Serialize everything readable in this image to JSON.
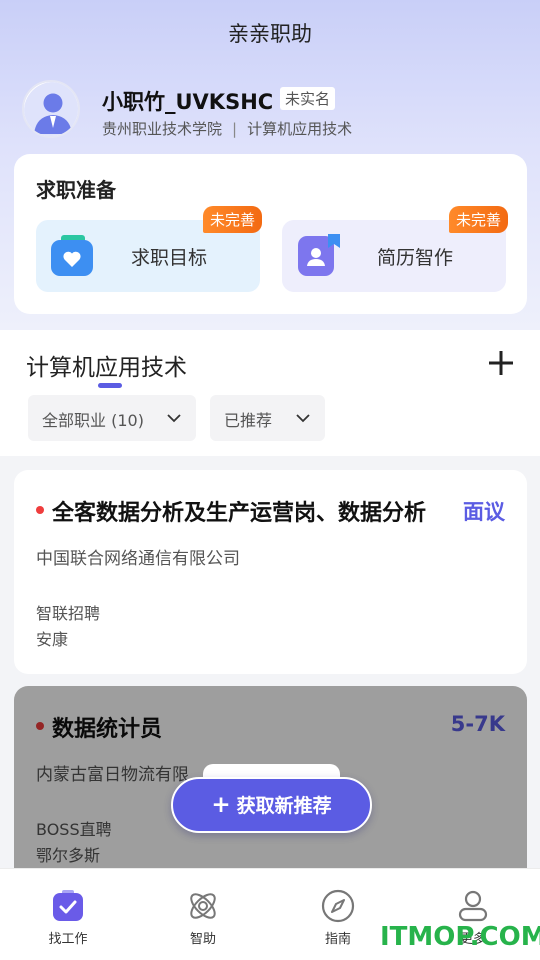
{
  "header": {
    "title": "亲亲职助"
  },
  "profile": {
    "name": "小职竹_UVKSHC",
    "badge": "未实名",
    "school": "贵州职业技术学院",
    "separator": "|",
    "major": "计算机应用技术"
  },
  "prep": {
    "title": "求职准备",
    "items": [
      {
        "label": "求职目标",
        "badge": "未完善",
        "icon": "heart-bag-icon"
      },
      {
        "label": "简历智作",
        "badge": "未完善",
        "icon": "resume-person-icon"
      }
    ]
  },
  "section": {
    "title": "计算机应用技术",
    "filters": [
      {
        "label": "全部职业 (10)"
      },
      {
        "label": "已推荐"
      }
    ]
  },
  "jobs": [
    {
      "title": "全客数据分析及生产运营岗、数据分析",
      "salary": "面议",
      "company": "中国联合网络通信有限公司",
      "source": "智联招聘",
      "city": "安康"
    },
    {
      "title": "数据统计员",
      "salary": "5-7K",
      "company": "内蒙古富日物流有限",
      "source": "BOSS直聘",
      "city": "鄂尔多斯"
    }
  ],
  "fab": {
    "label": "获取新推荐",
    "plus": "+"
  },
  "tabs": [
    {
      "label": "找工作",
      "icon": "briefcase-check-icon"
    },
    {
      "label": "智助",
      "icon": "atom-icon"
    },
    {
      "label": "指南",
      "icon": "compass-icon"
    },
    {
      "label": "更多",
      "icon": "user-icon"
    }
  ],
  "watermark": "ITMOP.COM",
  "colors": {
    "accent": "#5b5ce3",
    "badge": "#f36a12",
    "dot": "#ef3d3d"
  }
}
